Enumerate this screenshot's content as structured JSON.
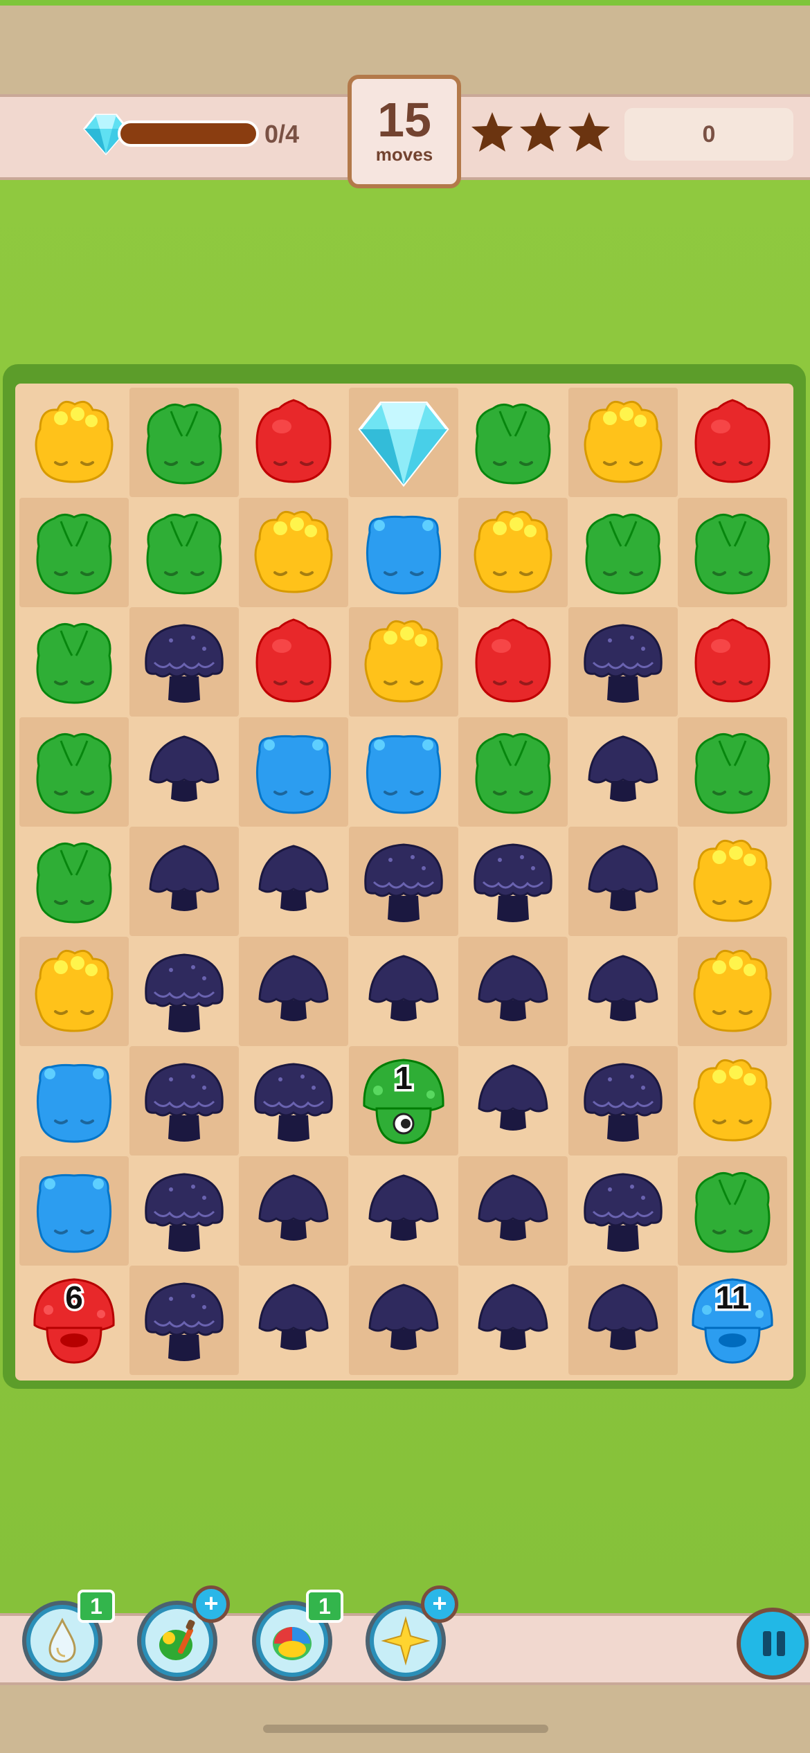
{
  "hud": {
    "goal": {
      "label": "0/4",
      "collected": 0,
      "target": 4,
      "item": "diamond-icon"
    },
    "moves": {
      "count": "15",
      "label": "moves"
    },
    "stars": {
      "earned": 0,
      "total": 3
    },
    "score": "0"
  },
  "board": {
    "rows": 9,
    "cols": 7,
    "grid": [
      [
        "yellow",
        "green",
        "red",
        "diamond",
        "green",
        "yellow",
        "red"
      ],
      [
        "green",
        "green",
        "yellow",
        "blue",
        "yellow",
        "green",
        "green"
      ],
      [
        "green",
        "mushroom-large",
        "red",
        "yellow",
        "red",
        "mushroom-large",
        "red"
      ],
      [
        "green",
        "mushroom-small",
        "blue",
        "blue",
        "green",
        "mushroom-small",
        "green"
      ],
      [
        "green",
        "mushroom-small",
        "mushroom-small",
        "mushroom-large",
        "mushroom-large",
        "mushroom-small",
        "yellow"
      ],
      [
        "yellow",
        "mushroom-large",
        "mushroom-small",
        "mushroom-small",
        "mushroom-small",
        "mushroom-small",
        "yellow"
      ],
      [
        "blue",
        "mushroom-large",
        "mushroom-large",
        "spawner-green",
        "mushroom-small",
        "mushroom-large",
        "yellow"
      ],
      [
        "blue",
        "mushroom-large",
        "mushroom-small",
        "mushroom-small",
        "mushroom-small",
        "mushroom-large",
        "green"
      ],
      [
        "spawner-red",
        "mushroom-large",
        "mushroom-small",
        "mushroom-small",
        "mushroom-small",
        "mushroom-small",
        "spawner-blue"
      ]
    ],
    "spawner_counts": {
      "spawner-green": "1",
      "spawner-red": "6",
      "spawner-blue": "11"
    }
  },
  "boosters": [
    {
      "name": "water-drop-booster",
      "icon": "water-drop-icon",
      "count": "1"
    },
    {
      "name": "paint-brush-booster",
      "icon": "paint-brush-icon",
      "count": "+"
    },
    {
      "name": "rainbow-jelly-booster",
      "icon": "rainbow-jelly-icon",
      "count": "1"
    },
    {
      "name": "sparkle-booster",
      "icon": "sparkle-icon",
      "count": "+"
    }
  ],
  "colors": {
    "yellow": "#ffc21a",
    "green": "#2fae36",
    "red": "#e8282a",
    "blue": "#2c9df0",
    "mushroom": "#2f2a5e",
    "board_bg": "#f1cfa6",
    "board_dark": "#e6bd92",
    "grass": "#8dc63f",
    "moves_text": "#734330"
  }
}
